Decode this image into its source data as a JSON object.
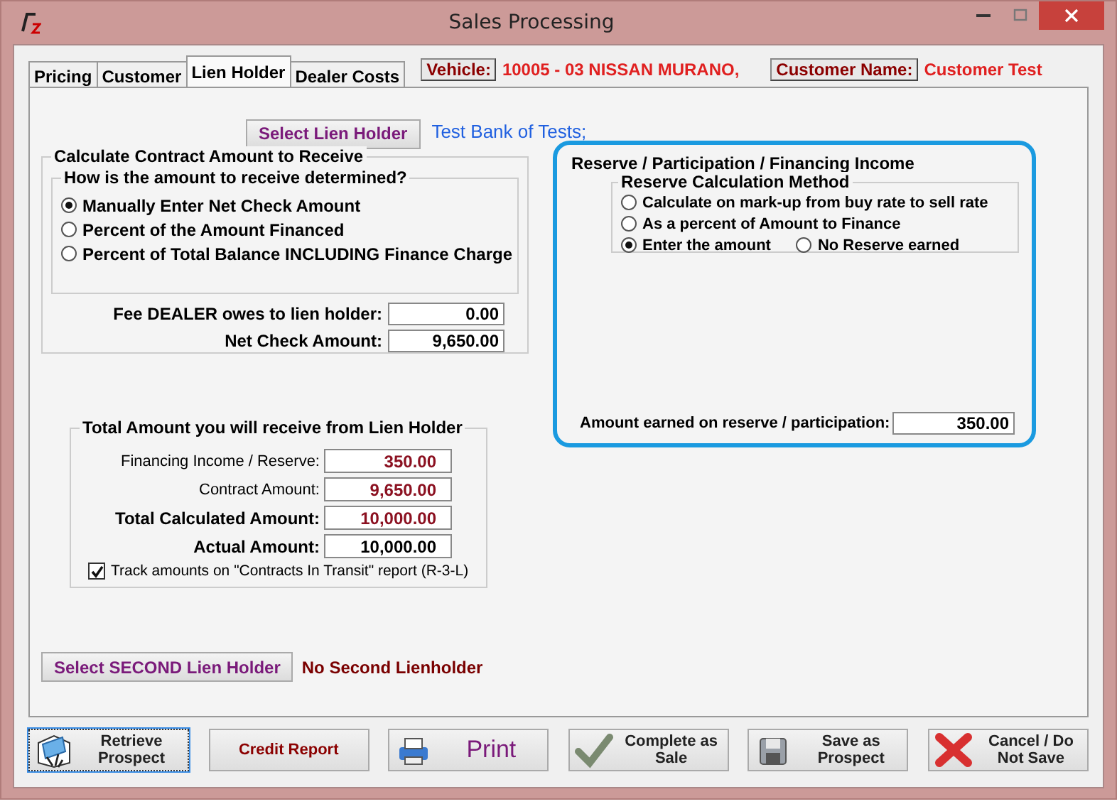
{
  "window": {
    "title": "Sales Processing"
  },
  "tabs": [
    {
      "label": "Pricing",
      "selected": false
    },
    {
      "label": "Customer",
      "selected": false
    },
    {
      "label": "Lien Holder",
      "selected": true
    },
    {
      "label": "Dealer Costs",
      "selected": false
    }
  ],
  "header": {
    "vehicle_label": "Vehicle:",
    "vehicle_value": "10005 - 03 NISSAN MURANO,",
    "customer_label": "Customer Name:",
    "customer_value": "Customer Test"
  },
  "lien_holder": {
    "button": "Select Lien Holder",
    "name": "Test Bank of Tests;"
  },
  "contract": {
    "title": "Calculate Contract Amount to Receive",
    "question": "How is the amount to receive determined?",
    "options": [
      {
        "label": "Manually Enter Net Check Amount",
        "selected": true
      },
      {
        "label": "Percent of the Amount Financed",
        "selected": false
      },
      {
        "label": "Percent of Total Balance INCLUDING Finance Charge",
        "selected": false
      }
    ],
    "fields": [
      {
        "label": "Fee DEALER owes to lien holder:",
        "value": "0.00"
      },
      {
        "label": "Net Check Amount:",
        "value": "9,650.00"
      }
    ]
  },
  "reserve": {
    "title": "Reserve / Participation / Financing Income",
    "method_title": "Reserve Calculation Method",
    "options": [
      {
        "label": "Calculate on mark-up from buy rate to sell rate",
        "selected": false
      },
      {
        "label": "As a percent of Amount to Finance",
        "selected": false
      },
      {
        "label": "Enter the amount",
        "selected": true
      },
      {
        "label": "No Reserve earned",
        "selected": false
      }
    ],
    "field": {
      "label": "Amount earned on reserve / participation:",
      "value": "350.00"
    }
  },
  "totals": {
    "title": "Total Amount you will receive from Lien Holder",
    "rows": [
      {
        "label": "Financing Income / Reserve:",
        "value": "350.00",
        "bold": false,
        "calculated": true
      },
      {
        "label": "Contract Amount:",
        "value": "9,650.00",
        "bold": false,
        "calculated": true
      },
      {
        "label": "Total Calculated Amount:",
        "value": "10,000.00",
        "bold": true,
        "calculated": true
      },
      {
        "label": "Actual Amount:",
        "value": "10,000.00",
        "bold": true,
        "calculated": false
      }
    ],
    "checkbox": {
      "label": "Track amounts on \"Contracts In Transit\" report (R-3-L)",
      "checked": true
    }
  },
  "second_lien": {
    "button": "Select SECOND Lien Holder",
    "text": "No Second Lienholder"
  },
  "buttons": [
    {
      "label": "Retrieve Prospect",
      "kind": "retrieve",
      "focused": true
    },
    {
      "label": "Credit Report",
      "kind": "plain",
      "focused": false
    },
    {
      "label": "Print",
      "kind": "print",
      "focused": false
    },
    {
      "label": "Complete as Sale",
      "kind": "complete",
      "focused": false
    },
    {
      "label": "Save as Prospect",
      "kind": "save",
      "focused": false
    },
    {
      "label": "Cancel / Do Not Save",
      "kind": "cancel",
      "focused": false
    }
  ]
}
